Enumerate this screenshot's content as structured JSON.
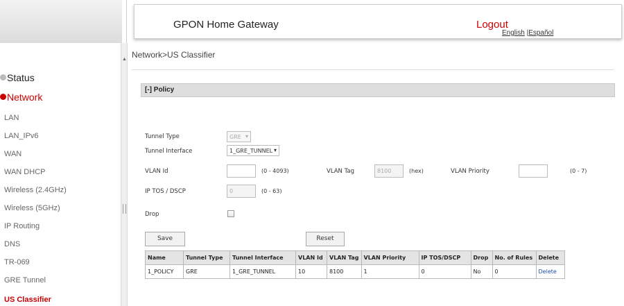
{
  "header": {
    "title": "GPON Home Gateway",
    "logout": "Logout",
    "lang_english": "English",
    "lang_sep": " |",
    "lang_spanish": "Español"
  },
  "sidebar": {
    "status": "Status",
    "network": "Network",
    "items": [
      "LAN",
      "LAN_IPv6",
      "WAN",
      "WAN DHCP",
      "Wireless (2.4GHz)",
      "Wireless (5GHz)",
      "IP Routing",
      "DNS",
      "TR-069",
      "GRE Tunnel",
      "US Classifier"
    ],
    "active": "US Classifier"
  },
  "breadcrumb": "Network>US Classifier",
  "policy": {
    "title": "[-] Policy",
    "tunnel_type_label": "Tunnel Type",
    "tunnel_type_value": "GRE",
    "tunnel_interface_label": "Tunnel Interface",
    "tunnel_interface_value": "1_GRE_TUNNEL",
    "vlan_id_label": "VLAN Id",
    "vlan_id_value": "",
    "vlan_id_hint": "(0 - 4093)",
    "vlan_tag_label": "VLAN Tag",
    "vlan_tag_value": "8100",
    "vlan_tag_hint": "(hex)",
    "vlan_priority_label": "VLAN Priority",
    "vlan_priority_value": "",
    "vlan_priority_hint": "(0 - 7)",
    "iptos_label": "IP TOS / DSCP",
    "iptos_value": "0",
    "iptos_hint": "(0 - 63)",
    "drop_label": "Drop",
    "drop_checked": false,
    "save_label": "Save",
    "reset_label": "Reset"
  },
  "table": {
    "headers": [
      "Name",
      "Tunnel Type",
      "Tunnel Interface",
      "VLAN Id",
      "VLAN Tag",
      "VLAN Priority",
      "IP TOS/DSCP",
      "Drop",
      "No. of Rules",
      "Delete"
    ],
    "rows": [
      [
        "1_POLICY",
        "GRE",
        "1_GRE_TUNNEL",
        "10",
        "8100",
        "1",
        "0",
        "No",
        "0",
        "Delete"
      ]
    ]
  },
  "colors": {
    "accent": "#cc0000",
    "link": "#1a4fa8"
  }
}
